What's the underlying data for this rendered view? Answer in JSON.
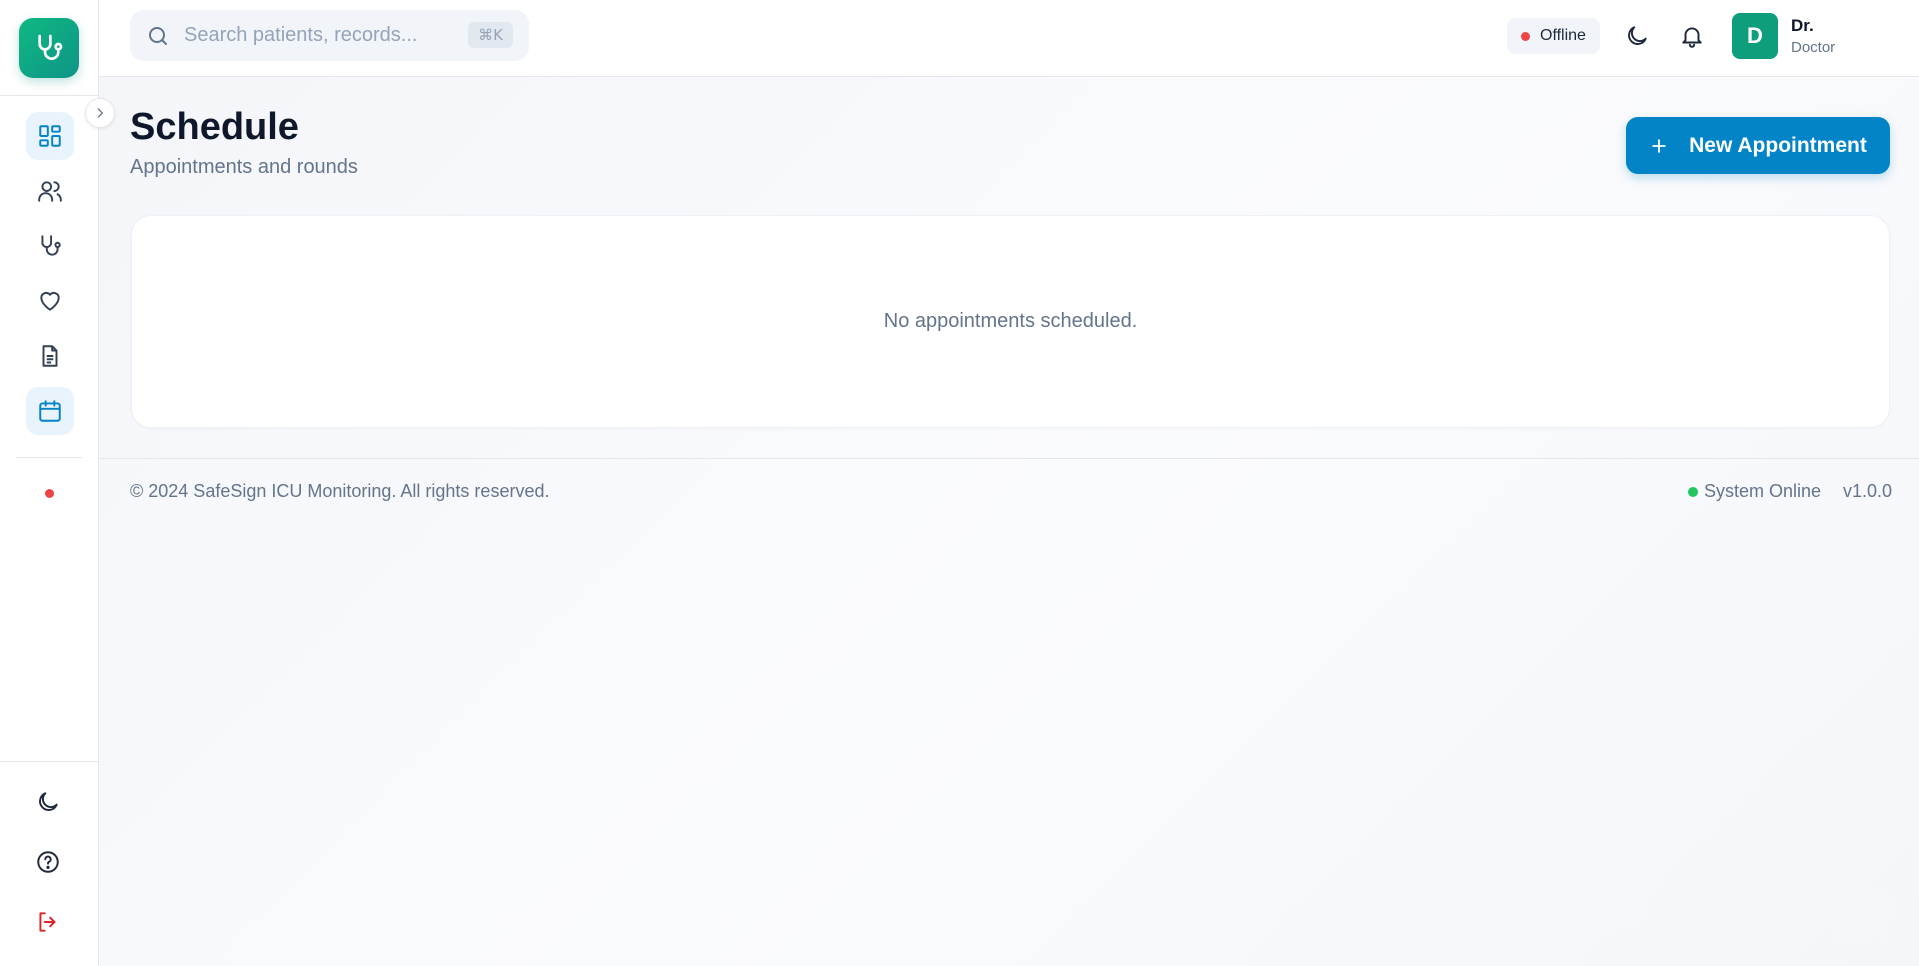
{
  "header": {
    "search_placeholder": "Search patients, records...",
    "search_shortcut": "⌘K",
    "connection_status": "Offline",
    "user": {
      "initial": "D",
      "name": "Dr.",
      "role": "Doctor"
    }
  },
  "sidebar": {
    "items": [
      {
        "icon": "dashboard-icon",
        "active": true
      },
      {
        "icon": "users-icon",
        "active": false
      },
      {
        "icon": "stethoscope-icon",
        "active": false
      },
      {
        "icon": "heart-icon",
        "active": false
      },
      {
        "icon": "document-icon",
        "active": false
      },
      {
        "icon": "calendar-icon",
        "active": true
      }
    ],
    "bottom": [
      "moon-icon",
      "help-icon",
      "logout-icon"
    ]
  },
  "main": {
    "title": "Schedule",
    "subtitle": "Appointments and rounds",
    "new_button_label": "New Appointment",
    "empty_message": "No appointments scheduled."
  },
  "footer": {
    "copyright": "© 2024 SafeSign ICU Monitoring. All rights reserved.",
    "system_status": "System Online",
    "version": "v1.0.0"
  },
  "colors": {
    "brand": "#0d9488",
    "primary": "#0284c7",
    "offline": "#ef4444",
    "online": "#22c55e"
  }
}
